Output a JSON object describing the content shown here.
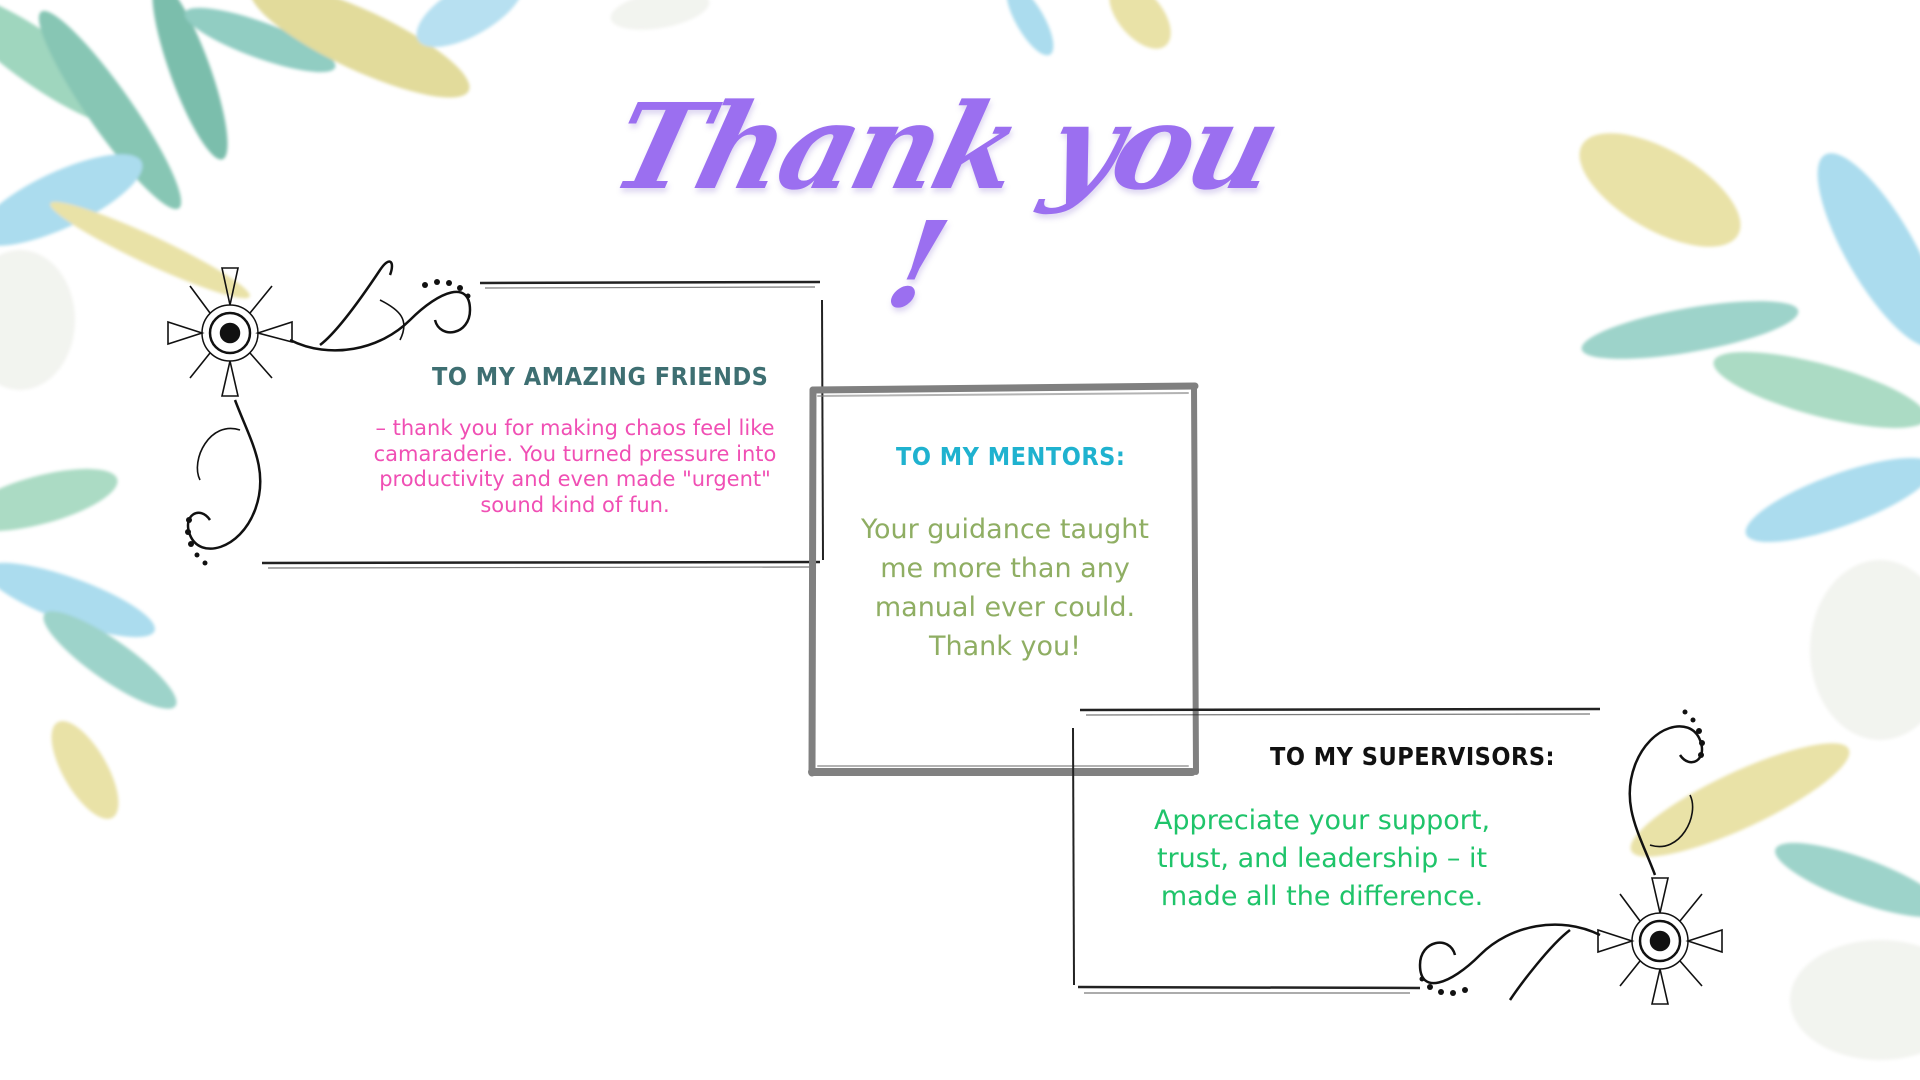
{
  "slide": {
    "title": "Thank you !",
    "cards": [
      {
        "heading": "To my amazing friends",
        "body": "– thank you for making chaos feel like camaraderie. You turned pressure into productivity and even made \"urgent\" sound kind of fun."
      },
      {
        "heading": "To my Mentors:",
        "body": "Your guidance taught me more than any manual ever could. Thank you!"
      },
      {
        "heading": "To my supervisors:",
        "body": "Appreciate your support, trust, and leadership – it made all the difference."
      }
    ]
  },
  "colors": {
    "title": "#9b6ff0",
    "friends_heading": "#3e6f72",
    "friends_body": "#f04fb4",
    "mentors_heading": "#1fb2cf",
    "mentors_body": "#8fae63",
    "supervisors_heading": "#111111",
    "supervisors_body": "#1fc46a",
    "leaf_teal": "#7dc4b8",
    "leaf_blue": "#8fd0e8",
    "leaf_gold": "#d8cf7a",
    "frame_gray": "#808080",
    "flourish": "#111111"
  },
  "decor": {
    "icons": [
      "watercolor-leaves",
      "flourish-corner"
    ]
  }
}
